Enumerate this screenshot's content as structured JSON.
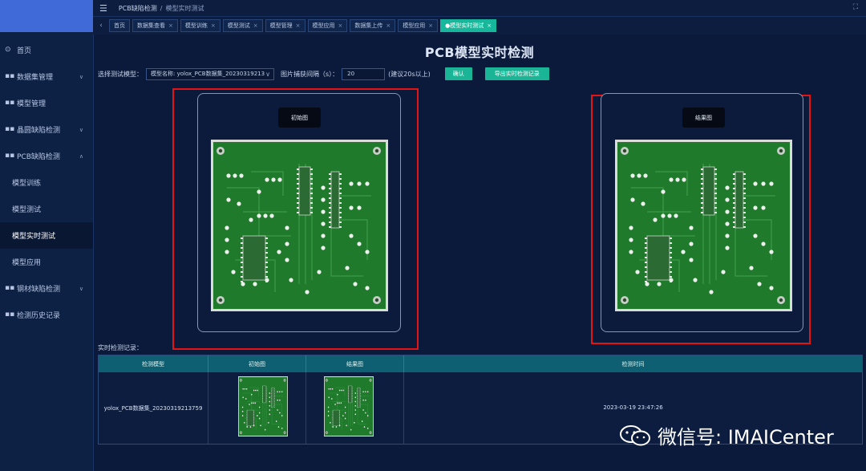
{
  "topbar": {
    "breadcrumb_root": "PCB缺陷检测",
    "breadcrumb_sep": "/",
    "breadcrumb_current": "模型实时测试"
  },
  "sidebar": {
    "items": [
      {
        "label": "首页",
        "icon": "home-icon"
      },
      {
        "label": "数据集管理",
        "icon": "grid-icon",
        "expandable": true
      },
      {
        "label": "模型管理",
        "icon": "grid-icon"
      },
      {
        "label": "晶圆缺陷检测",
        "icon": "grid-icon",
        "expandable": true
      },
      {
        "label": "PCB缺陷检测",
        "icon": "grid-icon",
        "expandable": true,
        "expanded": true
      },
      {
        "label": "模型训练",
        "sub": true
      },
      {
        "label": "模型测试",
        "sub": true
      },
      {
        "label": "模型实时测试",
        "sub": true,
        "active": true
      },
      {
        "label": "模型应用",
        "sub": true
      },
      {
        "label": "钢材缺陷检测",
        "icon": "grid-icon",
        "expandable": true
      },
      {
        "label": "检测历史记录",
        "icon": "grid-icon"
      }
    ]
  },
  "tabs": [
    {
      "label": "首页"
    },
    {
      "label": "数据集查看",
      "closable": true
    },
    {
      "label": "模型训练",
      "closable": true
    },
    {
      "label": "模型测试",
      "closable": true
    },
    {
      "label": "模型管理",
      "closable": true
    },
    {
      "label": "模型应用",
      "closable": true
    },
    {
      "label": "数据集上传",
      "closable": true
    },
    {
      "label": "模型应用",
      "closable": true
    },
    {
      "label": "●模型实时测试",
      "closable": true,
      "active": true
    }
  ],
  "main": {
    "title": "PCB模型实时检测",
    "select_label": "选择测试模型：",
    "select_value": "模型名称: yolox_PCB数据集_20230319213",
    "interval_label": "图片捕获间隔（s）：",
    "interval_value": "20",
    "interval_hint": "(建议20s以上)",
    "confirm_label": "确认",
    "export_label": "导出实时检测记录",
    "original_label": "初始图",
    "result_label": "结果图"
  },
  "records": {
    "title": "实时检测记录：",
    "columns": [
      "检测模型",
      "初始图",
      "结果图",
      "检测时间"
    ],
    "rows": [
      {
        "model": "yolox_PCB数据集_20230319213759",
        "time": "2023-03-19 23:47:26"
      }
    ]
  },
  "watermark": {
    "text": "微信号: IMAICenter"
  },
  "colors": {
    "accent": "#19b596",
    "highlight_border": "#e41414",
    "background": "#0b1a3a",
    "pcb_green": "#1f7a2c"
  }
}
